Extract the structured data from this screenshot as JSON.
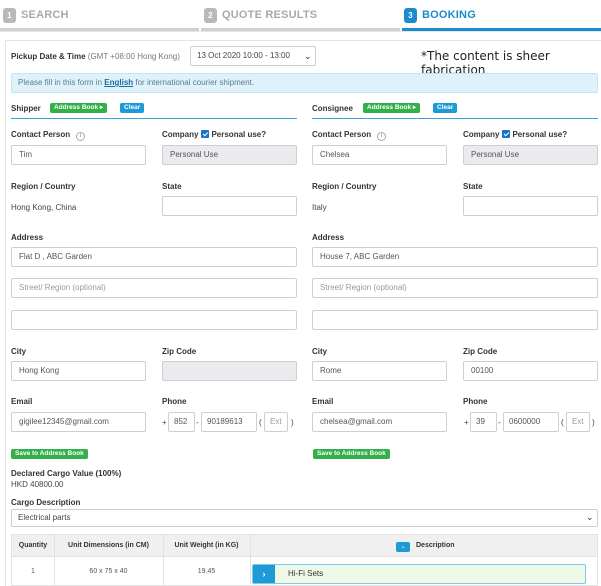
{
  "steps": [
    {
      "num": "1",
      "label": "SEARCH"
    },
    {
      "num": "2",
      "label": "QUOTE RESULTS"
    },
    {
      "num": "3",
      "label": "BOOKING"
    }
  ],
  "note": "*The content is sheer fabrication",
  "pickup": {
    "label": "Pickup Date & Time",
    "timezone": "(GMT +08:00 Hong Kong)",
    "value": "13 Oct 2020 10:00 - 13:00"
  },
  "info": {
    "prefix": "Please fill in this form in ",
    "link": "English",
    "suffix": " for international courier shipment."
  },
  "shipper": {
    "title": "Shipper",
    "address_book": "Address Book",
    "clear": "Clear",
    "contact_label": "Contact Person",
    "contact": "Tim",
    "company_label": "Company",
    "personal_use_label": "Personal use?",
    "company": "Personal Use",
    "region_label": "Region / Country",
    "region": "Hong Kong, China",
    "state_label": "State",
    "state": "",
    "address_label": "Address",
    "address1": "Flat D , ABC Garden",
    "address2_placeholder": "Street/ Region (optional)",
    "address3": "",
    "city_label": "City",
    "city": "Hong Kong",
    "zip_label": "Zip Code",
    "zip": "",
    "email_label": "Email",
    "email": "gigilee12345@gmail.com",
    "phone_label": "Phone",
    "phone_plus": "+",
    "phone_cc": "852",
    "phone_dash": "-",
    "phone_num": "90189613",
    "phone_open": "(",
    "phone_ext": "Ext",
    "phone_close": ")",
    "save": "Save to Address Book"
  },
  "consignee": {
    "title": "Consignee",
    "address_book": "Address Book",
    "clear": "Clear",
    "contact_label": "Contact Person",
    "contact": "Chelsea",
    "company_label": "Company",
    "personal_use_label": "Personal use?",
    "company": "Personal Use",
    "region_label": "Region / Country",
    "region": "Italy",
    "state_label": "State",
    "state": "",
    "address_label": "Address",
    "address1": "House 7,  ABC Garden",
    "address2_placeholder": "Street/ Region (optional)",
    "address3": "",
    "city_label": "City",
    "city": "Rome",
    "zip_label": "Zip Code",
    "zip": "00100",
    "email_label": "Email",
    "email": "chelsea@gmail.com",
    "phone_label": "Phone",
    "phone_plus": "+",
    "phone_cc": "39",
    "phone_dash": "-",
    "phone_num": "0600000",
    "phone_open": "(",
    "phone_ext": "Ext",
    "phone_close": ")",
    "save": "Save to Address Book"
  },
  "cargo": {
    "declared_label": "Declared Cargo Value (100%)",
    "declared_value": "HKD 40800.00",
    "description_label": "Cargo Description",
    "description_value": "Electrical parts"
  },
  "table": {
    "headers": [
      "Quantity",
      "Unit Dimensions (in CM)",
      "Unit Weight (in KG)",
      "Description"
    ],
    "rows": [
      {
        "quantity": "1",
        "dimensions": "60 x 75 x 40",
        "weight": "19.45",
        "description": "Hi-Fi Sets"
      }
    ]
  }
}
